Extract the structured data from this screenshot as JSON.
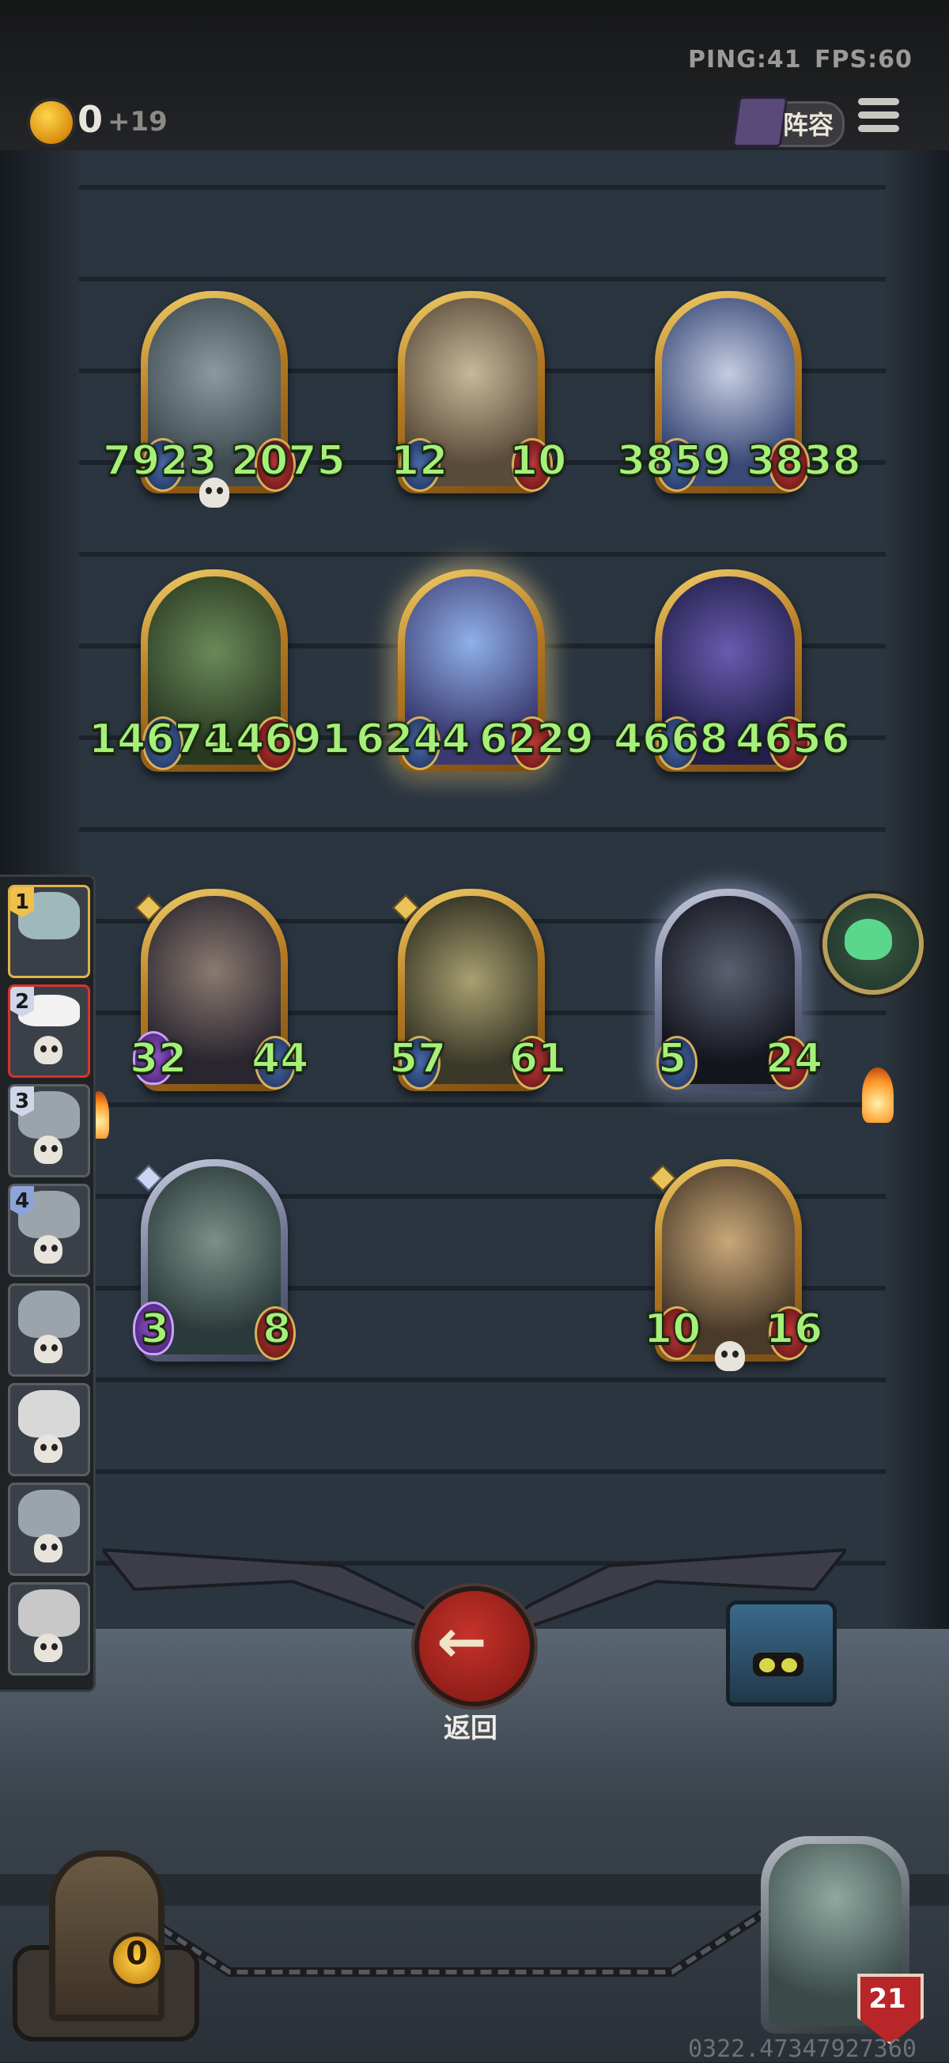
{
  "status": {
    "ping": "PING:41",
    "fps": "FPS:60"
  },
  "resources": {
    "coins": "0",
    "income": "+19"
  },
  "header": {
    "lineup_label": "阵容",
    "lineup_icon": "book-icon",
    "menu_icon": "hamburger-menu-icon"
  },
  "enemy_board": [
    {
      "name": "robot-minion-card",
      "attack": "7923",
      "health": "2075",
      "style": "gold",
      "dead": true
    },
    {
      "name": "rocket-minion-card",
      "attack": "12",
      "health": "10",
      "style": "gold",
      "dead": false
    },
    {
      "name": "king-minion-card",
      "attack": "3859",
      "health": "3838",
      "style": "gold",
      "dead": false
    },
    {
      "name": "goblin-minion-card",
      "attack": "14674",
      "health": "14691",
      "style": "gold",
      "dead": false
    },
    {
      "name": "sorceress-minion-card",
      "attack": "6244",
      "health": "6229",
      "style": "gold",
      "glow": true,
      "dead": false
    },
    {
      "name": "star-wizard-minion-card",
      "attack": "4668",
      "health": "4656",
      "style": "gold",
      "dead": false
    }
  ],
  "player_board": [
    {
      "name": "dragon-minion-card",
      "attack": "32",
      "health": "44",
      "style": "gold",
      "poison": true,
      "tier": "gold"
    },
    {
      "name": "submarine-minion-card",
      "attack": "57",
      "health": "61",
      "style": "gold",
      "tier": "gold"
    },
    {
      "name": "shadow-dragon-minion-card",
      "attack": "5",
      "health": "24",
      "style": "silver",
      "glow": true
    },
    {
      "name": "fishman-minion-card",
      "attack": "3",
      "health": "8",
      "style": "silver",
      "poison": true,
      "tier": "silver"
    },
    {
      "name": "pinocchio-minion-card",
      "attack": "10",
      "health": "16",
      "style": "gold",
      "dead": true,
      "tier": "gold"
    }
  ],
  "opponents": [
    {
      "rank": "1",
      "eliminated": false,
      "highlight": "gold"
    },
    {
      "rank": "2",
      "eliminated": true,
      "highlight": "red"
    },
    {
      "rank": "3",
      "eliminated": true
    },
    {
      "rank": "4",
      "eliminated": true
    },
    {
      "rank": "",
      "eliminated": true
    },
    {
      "rank": "",
      "eliminated": true
    },
    {
      "rank": "",
      "eliminated": true
    },
    {
      "rank": "",
      "eliminated": true
    }
  ],
  "actions": {
    "return_label": "返回",
    "return_icon": "arrow-left-icon",
    "frog_icon": "frog-icon",
    "chest_icon": "chest-mimic-icon"
  },
  "bottom": {
    "gold": "0",
    "hero_health": "21"
  },
  "seed": "0322.47347927360",
  "colors": {
    "stat_text": "#a6f07a",
    "gold_frame": "#d9a845",
    "return_button": "#b02a22"
  }
}
